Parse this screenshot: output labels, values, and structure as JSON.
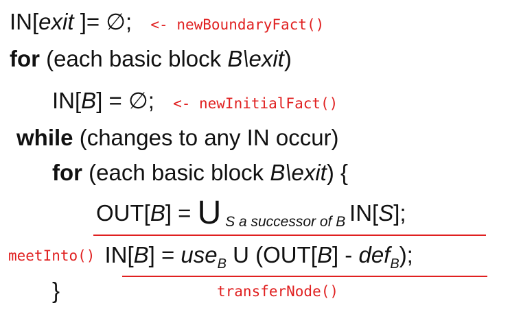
{
  "line1": {
    "in_open": "IN[",
    "exit": "exit",
    "close_eq": " ]= ∅;",
    "annotation": "<- newBoundaryFact()"
  },
  "line2": {
    "for_kw": "for",
    "open": " (each basic block ",
    "b_exit": "B\\exit",
    "close": ")"
  },
  "line3": {
    "in_open": "IN[",
    "b": "B",
    "close_eq": "] = ∅;",
    "annotation": "<- newInitialFact()"
  },
  "line4": {
    "while_kw": "while",
    "rest": " (changes to any IN occur)"
  },
  "line5": {
    "for_kw": "for",
    "open": " (each basic block ",
    "b_exit": "B\\exit",
    "close": ") {"
  },
  "line6": {
    "out_open": "OUT[",
    "b": "B",
    "mid": "] = ",
    "union": "U",
    "subscript": " S a successor of B ",
    "in_open": "IN[",
    "s": "S",
    "close": "];"
  },
  "line7": {
    "annotation": "meetInto()",
    "in_open": "IN[",
    "b": "B",
    "eq": "] = ",
    "use": "use",
    "use_sub": "B",
    "union": " U (OUT[",
    "b2": "B",
    "minus": "] - ",
    "def": "def",
    "def_sub": "B",
    "close": ");"
  },
  "line8": {
    "brace": "}",
    "annotation": "transferNode()"
  },
  "colors": {
    "text": "#111111",
    "annotation": "#e02020"
  }
}
